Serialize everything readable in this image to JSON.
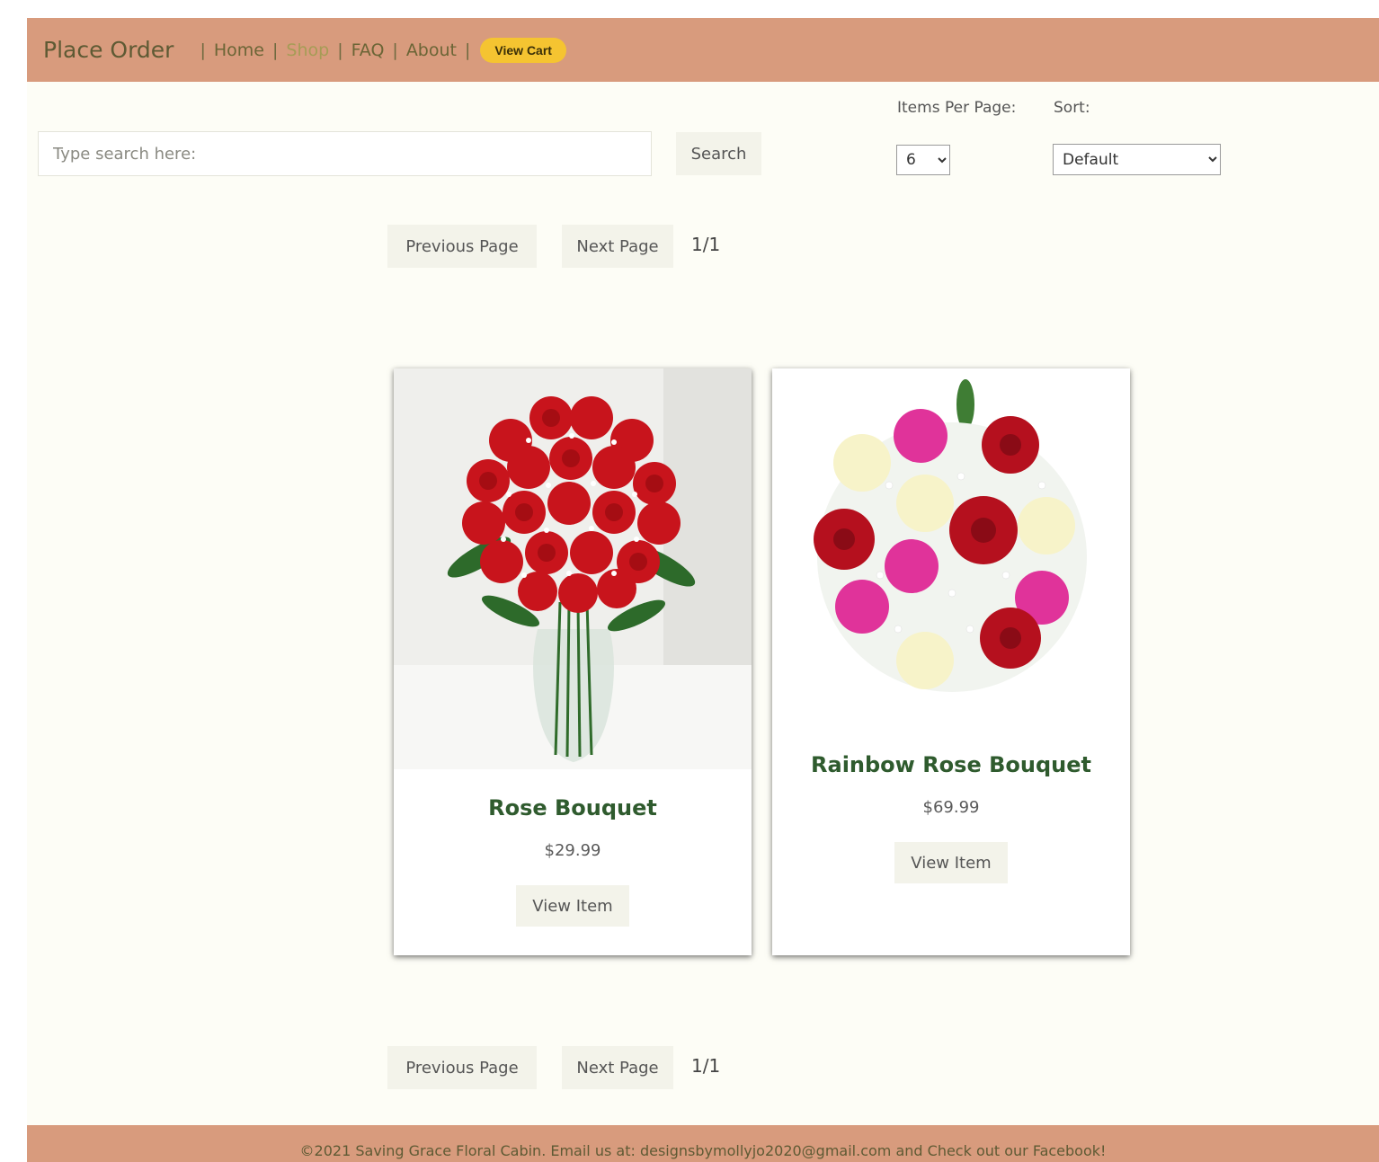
{
  "header": {
    "brand": "Place Order",
    "nav": [
      {
        "label": "Home"
      },
      {
        "label": "Shop"
      },
      {
        "label": "FAQ"
      },
      {
        "label": "About"
      }
    ],
    "separator": "|",
    "view_cart": "View Cart"
  },
  "search": {
    "placeholder": "Type search here:",
    "button": "Search"
  },
  "controls": {
    "items_per_page_label": "Items Per Page:",
    "items_per_page_value": "6",
    "sort_label": "Sort:",
    "sort_value": "Default"
  },
  "pagination": {
    "previous": "Previous Page",
    "next": "Next Page",
    "count": "1/1"
  },
  "products": [
    {
      "name": "Rose Bouquet",
      "price": "$29.99",
      "button": "View Item",
      "image": "red-roses-vase"
    },
    {
      "name": "Rainbow Rose Bouquet",
      "price": "$69.99",
      "button": "View Item",
      "image": "mixed-roses-bouquet"
    }
  ],
  "footer": {
    "text": "©2021 Saving Grace Floral Cabin. Email us at: designsbymollyjo2020@gmail.com and Check out our Facebook!"
  },
  "colors": {
    "header_bg": "#d89b7d",
    "page_bg": "#fdfdf6",
    "view_cart_bg": "#f5c431",
    "product_title": "#2f5b2e"
  }
}
